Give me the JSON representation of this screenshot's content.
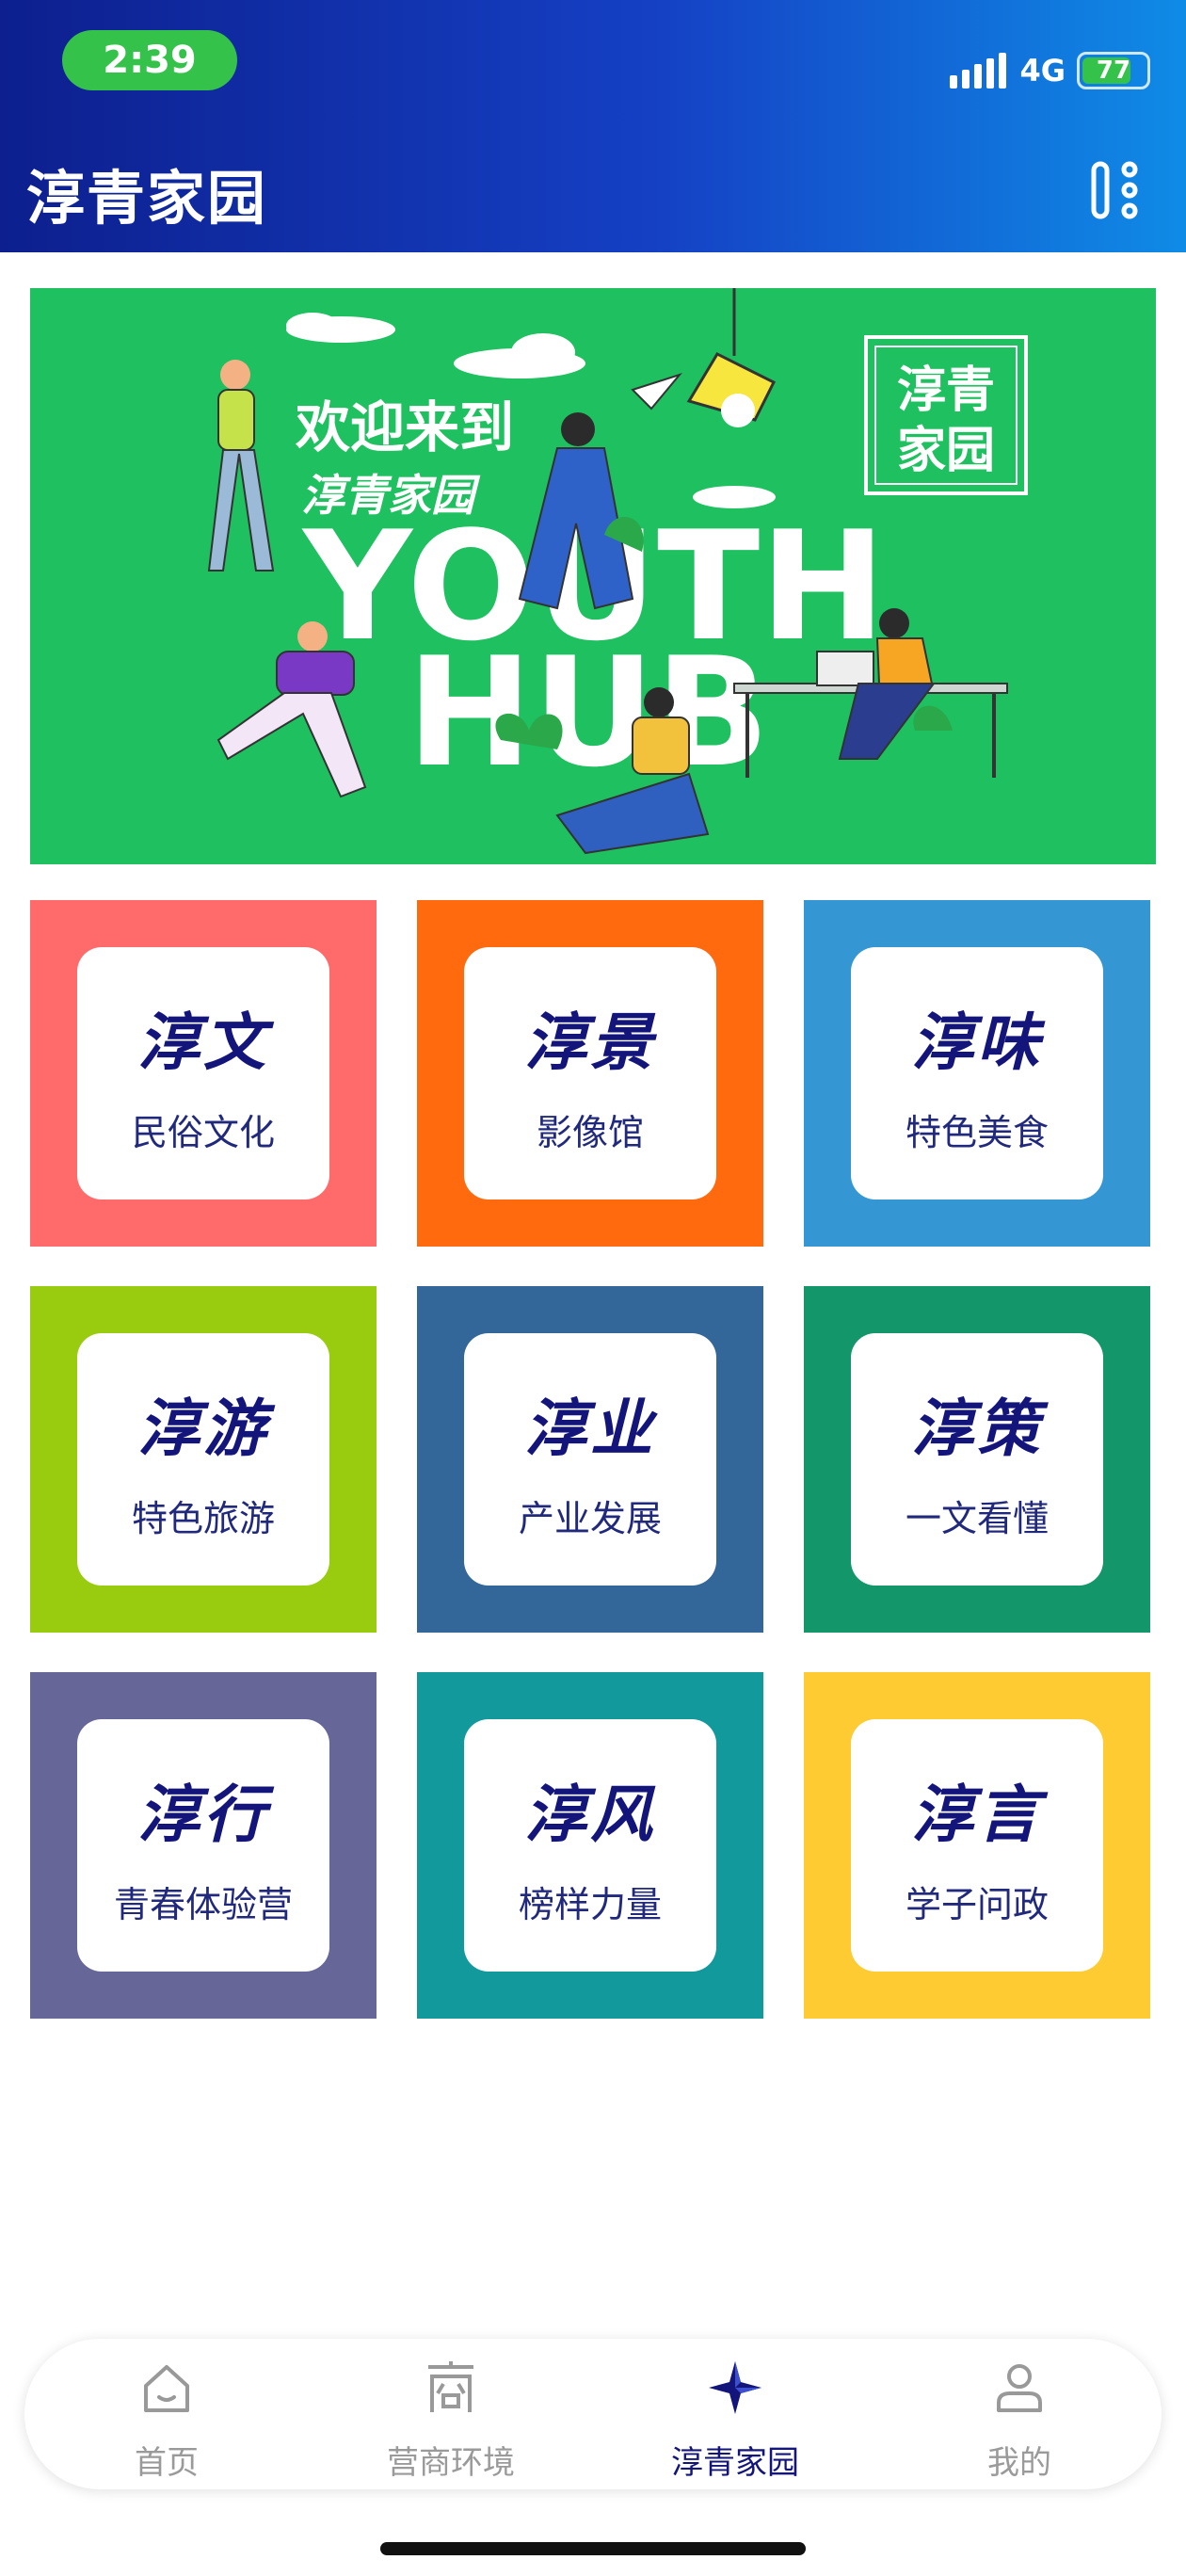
{
  "status_bar": {
    "time": "2:39",
    "network": "4G",
    "battery": "77",
    "battery_level": 0.77
  },
  "header": {
    "title": "淳青家园",
    "menu_icon": "more-icon"
  },
  "banner": {
    "line1": "欢迎来到",
    "line2": "淳青家园",
    "line3": "YOUTH",
    "line4": "HUB",
    "logo": [
      "淳青",
      "家园"
    ],
    "colors": {
      "background": "#1fc060"
    }
  },
  "tiles": [
    {
      "title": "淳文",
      "subtitle": "民俗文化",
      "color": "#ff6b6b"
    },
    {
      "title": "淳景",
      "subtitle": "影像馆",
      "color": "#ff6a0e"
    },
    {
      "title": "淳味",
      "subtitle": "特色美食",
      "color": "#3496d2"
    },
    {
      "title": "淳游",
      "subtitle": "特色旅游",
      "color": "#99cc0f"
    },
    {
      "title": "淳业",
      "subtitle": "产业发展",
      "color": "#336699"
    },
    {
      "title": "淳策",
      "subtitle": "一文看懂",
      "color": "#13976a"
    },
    {
      "title": "淳行",
      "subtitle": "青春体验营",
      "color": "#666699"
    },
    {
      "title": "淳风",
      "subtitle": "榜样力量",
      "color": "#12999b"
    },
    {
      "title": "淳言",
      "subtitle": "学子问政",
      "color": "#fecb33"
    }
  ],
  "tabbar": {
    "items": [
      {
        "label": "首页",
        "icon": "home-icon"
      },
      {
        "label": "营商环境",
        "icon": "shop-icon"
      },
      {
        "label": "淳青家园",
        "icon": "star-compass-icon"
      },
      {
        "label": "我的",
        "icon": "user-icon"
      }
    ],
    "active": 2
  }
}
